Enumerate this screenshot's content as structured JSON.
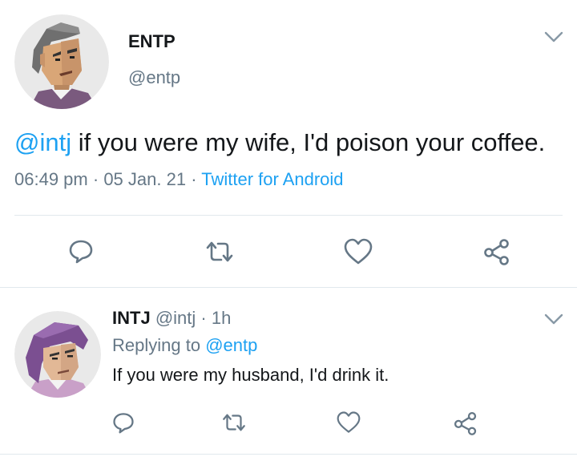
{
  "tweet": {
    "author_name": "ENTP",
    "author_handle": "@entp",
    "mention": "@intj",
    "text_rest": " if you were my wife, I'd poison your coffee.",
    "time": "06:49 pm",
    "sep1": "·",
    "date": "05 Jan. 21",
    "sep2": "·",
    "source": "Twitter for Android"
  },
  "reply": {
    "author_name": "INTJ",
    "author_handle": "@intj",
    "sep": "·",
    "time_ago": "1h",
    "replying_prefix": "Replying to",
    "replying_handle": "@entp",
    "text": "If you were my husband, I'd drink it."
  },
  "icons": {
    "reply": "speech-bubble-icon",
    "retweet": "retweet-icon",
    "like": "heart-icon",
    "share": "share-icon",
    "menu": "chevron-down-icon"
  },
  "colors": {
    "link": "#1da1f2",
    "muted": "#657786",
    "divider": "#e1e8ed"
  }
}
